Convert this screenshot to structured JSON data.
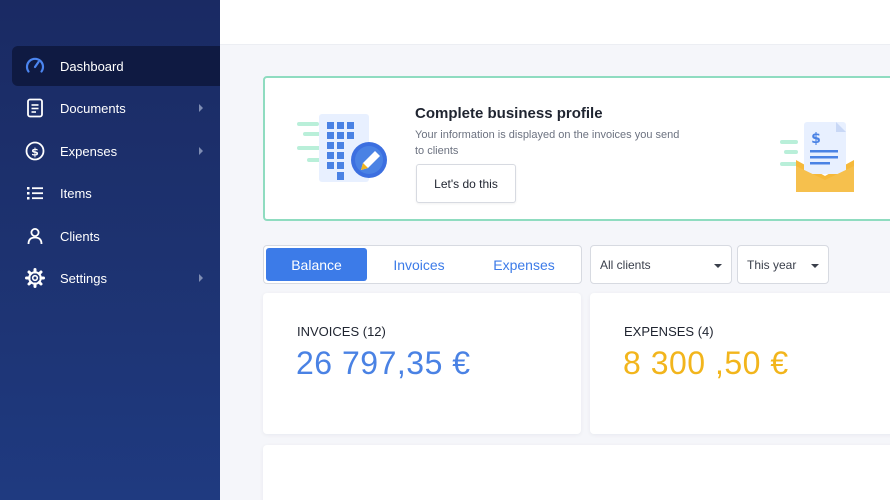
{
  "sidebar": {
    "items": [
      {
        "label": "Dashboard",
        "icon": "speedometer-icon",
        "active": true
      },
      {
        "label": "Documents",
        "icon": "document-icon",
        "has_submenu": true
      },
      {
        "label": "Expenses",
        "icon": "dollar-circle-icon",
        "has_submenu": true
      },
      {
        "label": "Items",
        "icon": "list-icon"
      },
      {
        "label": "Clients",
        "icon": "user-icon"
      },
      {
        "label": "Settings",
        "icon": "gear-icon",
        "has_submenu": true
      }
    ]
  },
  "banner": {
    "title": "Complete business profile",
    "description": "Your information is displayed on the invoices you send to clients",
    "button_label": "Let's do this",
    "left_illustration": "building-pencil-illustration",
    "right_illustration": "invoice-envelope-illustration"
  },
  "filters": {
    "tabs": [
      {
        "label": "Balance",
        "active": true
      },
      {
        "label": "Invoices",
        "active": false
      },
      {
        "label": "Expenses",
        "active": false
      }
    ],
    "client_select": "All clients",
    "period_select": "This year"
  },
  "stats": {
    "invoices": {
      "label": "INVOICES (12)",
      "value": "26 797,35 €"
    },
    "expenses": {
      "label": "EXPENSES (4)",
      "value": "8 300 ,50 €"
    }
  },
  "colors": {
    "sidebar_bg": "#1d3270",
    "sidebar_active": "#0f1a42",
    "accent_blue": "#3c7be8",
    "invoice_value": "#4a82e4",
    "expense_value": "#f2b51c",
    "banner_border": "#8fdcc0"
  }
}
